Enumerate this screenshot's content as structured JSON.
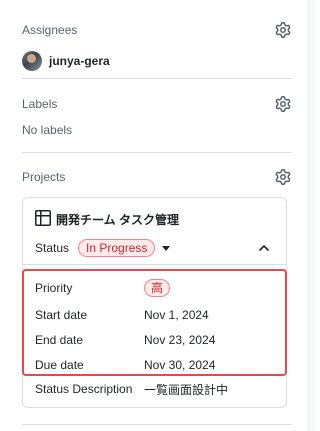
{
  "assignees": {
    "title": "Assignees",
    "user": "junya-gera"
  },
  "labels": {
    "title": "Labels",
    "empty": "No labels"
  },
  "projects": {
    "title": "Projects",
    "project_name": "開発チーム タスク管理",
    "status_label": "Status",
    "status_value": "In Progress",
    "fields": [
      {
        "label": "Priority",
        "value": "高"
      },
      {
        "label": "Start date",
        "value": "Nov 1, 2024"
      },
      {
        "label": "End date",
        "value": "Nov 23, 2024"
      },
      {
        "label": "Due date",
        "value": "Nov 30, 2024"
      },
      {
        "label": "Status Description",
        "value": "一覧画面設計中"
      }
    ]
  },
  "icons": {
    "settings": "gear-icon",
    "project": "table-icon",
    "dropdown": "triangle-down-icon",
    "collapse": "chevron-up-icon"
  },
  "colors": {
    "accent_red": "#cf222e",
    "pill_bg": "#ffebe9",
    "highlight": "#e5484d"
  }
}
